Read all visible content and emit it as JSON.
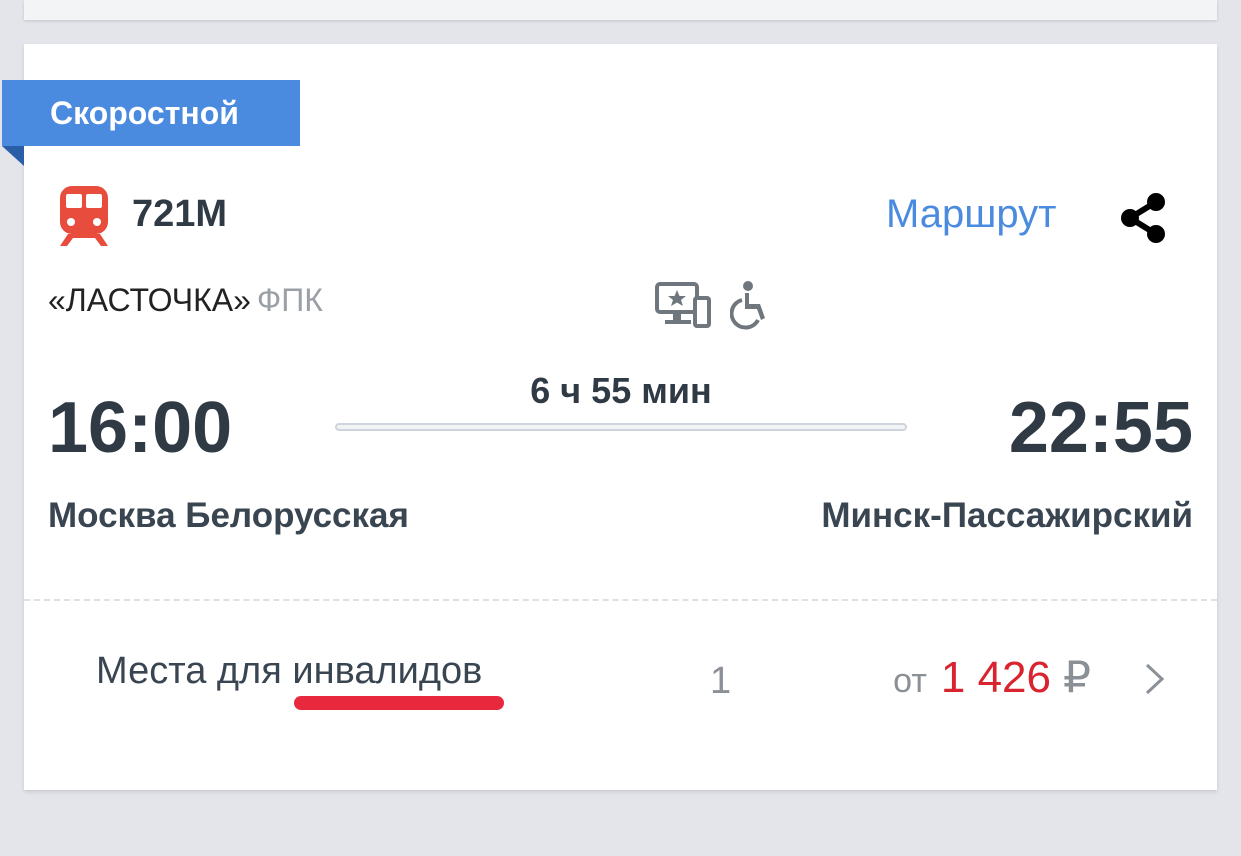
{
  "train": {
    "category_badge": "Скоростной",
    "number": "721М",
    "route_link": "Маршрут",
    "name": "«ЛАСТОЧКА»",
    "carrier": "ФПК",
    "amenities": [
      "media-screen-icon",
      "wheelchair-icon"
    ]
  },
  "schedule": {
    "departure_time": "16:00",
    "arrival_time": "22:55",
    "duration": "6 ч 55 мин",
    "departure_station": "Москва Белорусская",
    "arrival_station": "Минск-Пассажирский"
  },
  "seats": {
    "type_label": "Места для инвалидов",
    "count": "1",
    "price_prefix": "от",
    "price": "1 426",
    "currency": "₽"
  },
  "colors": {
    "badge": "#4a8be0",
    "link": "#4a8be0",
    "train_icon": "#e84c3d",
    "price": "#d9232e",
    "annotation_underline": "#e8283c"
  }
}
